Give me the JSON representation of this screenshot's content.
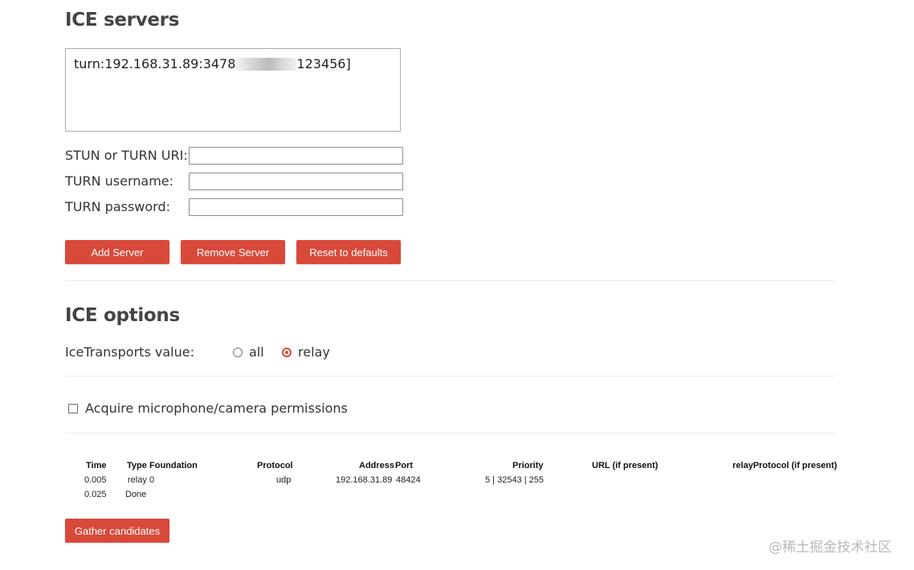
{
  "ice_servers": {
    "heading": "ICE servers",
    "server_list": {
      "entry_prefix": "turn:192.168.31.89:3478",
      "entry_suffix": "123456]"
    },
    "fields": {
      "uri_label": "STUN or TURN URI:",
      "uri_value": "",
      "username_label": "TURN username:",
      "username_value": "",
      "password_label": "TURN password:",
      "password_value": ""
    },
    "buttons": {
      "add": "Add Server",
      "remove": "Remove Server",
      "reset": "Reset to defaults"
    }
  },
  "ice_options": {
    "heading": "ICE options",
    "transports_label": "IceTransports value:",
    "options": [
      {
        "label": "all",
        "checked": false
      },
      {
        "label": "relay",
        "checked": true
      }
    ],
    "permissions_label": "Acquire microphone/camera permissions",
    "permissions_checked": false
  },
  "candidates": {
    "headers": {
      "time": "Time",
      "type": "Type",
      "foundation": "Foundation",
      "protocol": "Protocol",
      "address": "Address",
      "port": "Port",
      "priority": "Priority",
      "url": "URL (if present)",
      "relay_protocol": "relayProtocol (if present)"
    },
    "rows": [
      {
        "time": "0.005",
        "type": "relay",
        "foundation": "0",
        "protocol": "udp",
        "address": "192.168.31.89",
        "port": "48424",
        "priority": "5 | 32543 | 255"
      },
      {
        "time": "0.025",
        "done": "Done"
      }
    ],
    "gather_button": "Gather candidates"
  },
  "watermark": "@稀土掘金技术社区",
  "colors": {
    "accent": "#d9493a",
    "heading": "#444444",
    "divider": "#ececec"
  }
}
